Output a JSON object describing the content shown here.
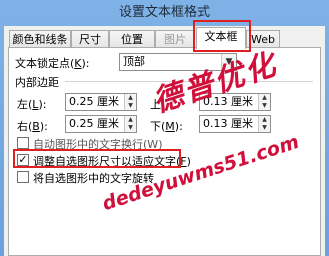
{
  "window": {
    "title": "设置文本框格式"
  },
  "tabs": [
    {
      "label": "颜色和线条"
    },
    {
      "label": "尺寸"
    },
    {
      "label": "位置"
    },
    {
      "label": "图片"
    },
    {
      "label": "文本框"
    },
    {
      "label": "Web"
    }
  ],
  "anchor": {
    "label": "文本锁定点(",
    "label_key": "K",
    "label_end": "):",
    "value": "顶部"
  },
  "margins": {
    "title": "内部边距",
    "left": {
      "label": "左(",
      "key": "L",
      "end": "):",
      "value": "0.25 厘米"
    },
    "top": {
      "label": "上",
      "value": "0.13 厘米"
    },
    "right": {
      "label": "右(",
      "key": "B",
      "end": "):",
      "value": "0.25 厘米"
    },
    "bottom": {
      "label": "下(",
      "key": "M",
      "end": "):",
      "value": "0.13 厘米"
    }
  },
  "checkboxes": [
    {
      "label": "自动图形中的文字换行(",
      "key": "W",
      "end": ")",
      "checked": false
    },
    {
      "label": "调整自选图形尺寸以适应文字(",
      "key": "F",
      "end": ")",
      "checked": true
    },
    {
      "label": "将自选图形中的文字旋转",
      "key": "",
      "end": "",
      "checked": false
    }
  ],
  "watermark": {
    "line1": "德普优化",
    "line2": "dedeyuwms51.com"
  },
  "colors": {
    "highlight": "#e02020",
    "watermark": "#d0103a"
  }
}
